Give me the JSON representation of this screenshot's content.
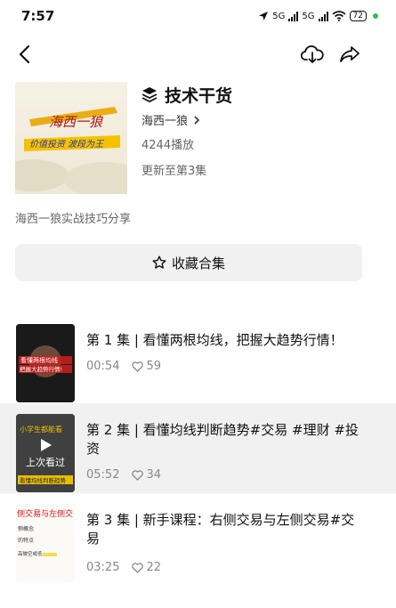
{
  "status_bar": {
    "time": "7:57",
    "network": "5G",
    "battery": "72"
  },
  "nav": {
    "back_icon": "chevron-left-icon",
    "download_icon": "cloud-download-icon",
    "share_icon": "share-icon"
  },
  "collection": {
    "title": "技术干货",
    "author": "海西一狼",
    "plays": "4244播放",
    "update": "更新至第3集",
    "description": "海西一狼实战技巧分享",
    "cover_text_line1": "海西一狼",
    "cover_text_line2": "价值投资 波段为王"
  },
  "collect_button": {
    "label": "收藏合集",
    "icon": "star-outline-icon"
  },
  "episodes": [
    {
      "title": "第 1 集 | 看懂两根均线，把握大趋势行情！",
      "duration": "00:54",
      "likes": "59",
      "thumb_line1": "看懂两根均线",
      "thumb_line2": "把握大趋势行情!"
    },
    {
      "title": "第 2 集 |  看懂均线判断趋势#交易 #理财 #投资",
      "duration": "05:52",
      "likes": "34",
      "badge": "上次看过",
      "thumb_top": "小学生都能看",
      "thumb_bottom": "看懂均线判断趋势"
    },
    {
      "title": "第 3 集 | 新手课程：右侧交易与左侧交易#交易",
      "duration": "03:25",
      "likes": "22",
      "thumb_top": "侧交易与左侧交",
      "thumb_lines": [
        "侧概念",
        "的特点",
        "高做空或低"
      ]
    }
  ],
  "colors": {
    "accent_gold": "#e8a500",
    "status_green": "#2dbd5c",
    "active_row_bg": "#f1f1f1"
  }
}
